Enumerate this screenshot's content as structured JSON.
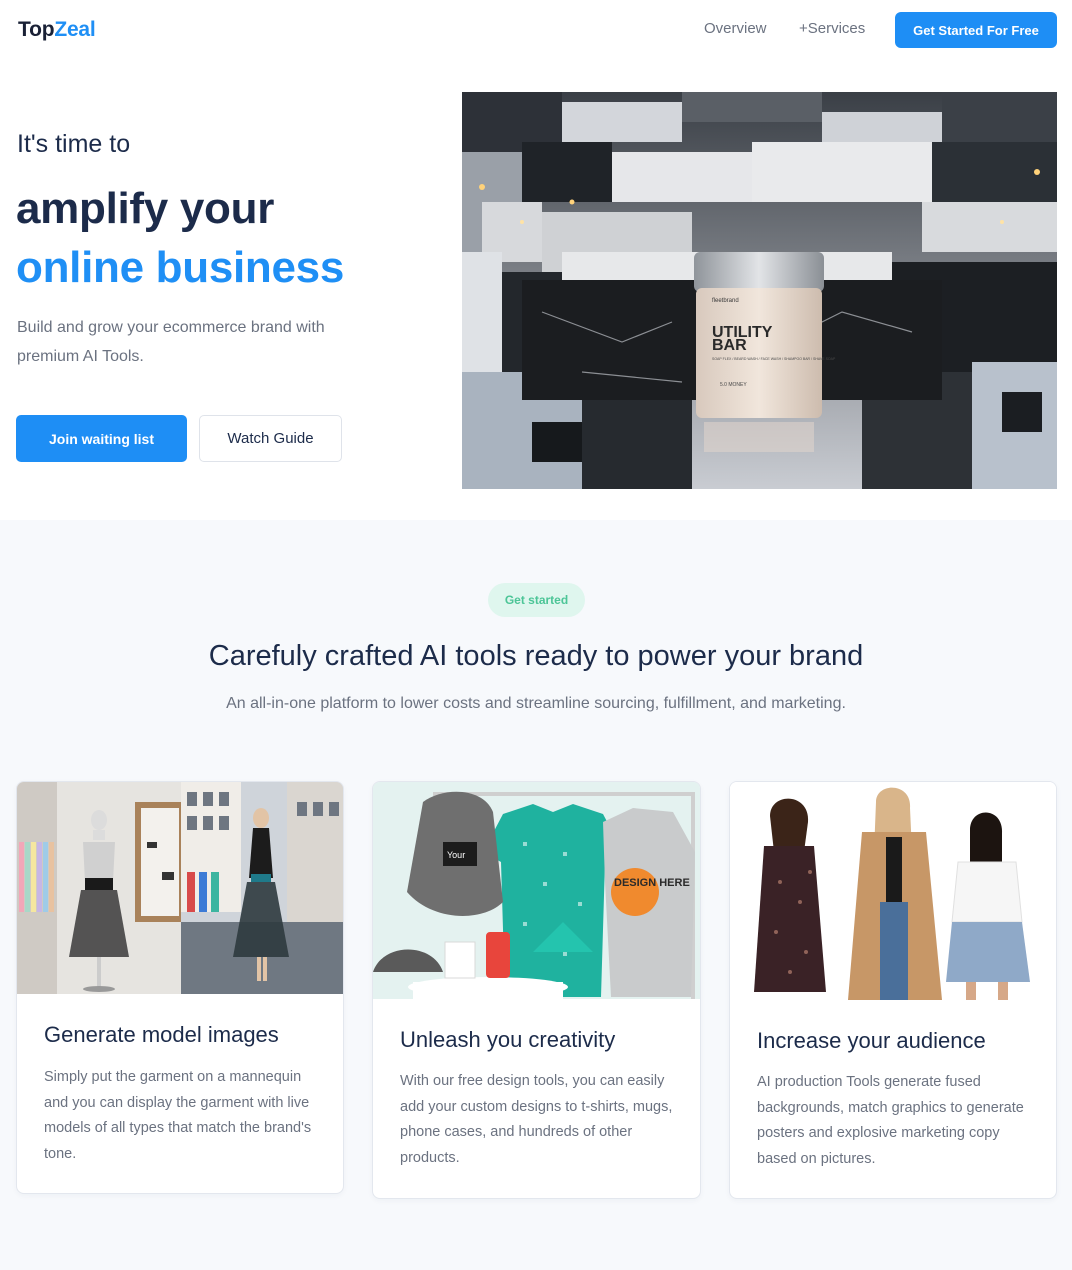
{
  "header": {
    "logo_part1": "Top",
    "logo_part2": "Zeal",
    "nav": [
      {
        "label": "Overview"
      },
      {
        "label": "+Services"
      }
    ],
    "cta_label": "Get Started For Free"
  },
  "hero": {
    "intro": "It's time to",
    "headline_line1": "amplify your",
    "headline_line2": "online business",
    "description": "Build and grow your ecommerce brand with premium AI Tools.",
    "primary_button": "Join waiting list",
    "secondary_button": "Watch Guide",
    "product_brand": "fleetbrand",
    "product_name_line1": "UTILITY",
    "product_name_line2": "BAR",
    "product_desc": "SOAP FLEX / BEARD WASH / FACE WASH / SHAMPOO BAR / SHAVE SOAP",
    "product_scent": "5.0 MONEY"
  },
  "features": {
    "badge": "Get started",
    "title": "Carefuly crafted AI tools ready to power your brand",
    "subtitle": "An all-in-one platform to lower costs and streamline sourcing, fulfillment, and marketing.",
    "cards": [
      {
        "title": "Generate model images",
        "text": "Simply put the garment on a mannequin and you can display the garment with live models of all types that match the brand's tone."
      },
      {
        "title": "Unleash you creativity",
        "text": "With our free design tools, you can easily add your custom designs to t-shirts, mugs, phone cases, and hundreds of other products.",
        "hoodie_text": "DESIGN HERE",
        "bag_text": "Your"
      },
      {
        "title": "Increase your audience",
        "text": "AI production Tools generate fused backgrounds, match graphics to generate posters and explosive marketing copy based on pictures."
      }
    ]
  },
  "colors": {
    "accent": "#1f8ff5",
    "heading": "#1c2b4a",
    "muted": "#6b7280",
    "badge_bg": "#dff6ee",
    "badge_text": "#4cc597"
  }
}
